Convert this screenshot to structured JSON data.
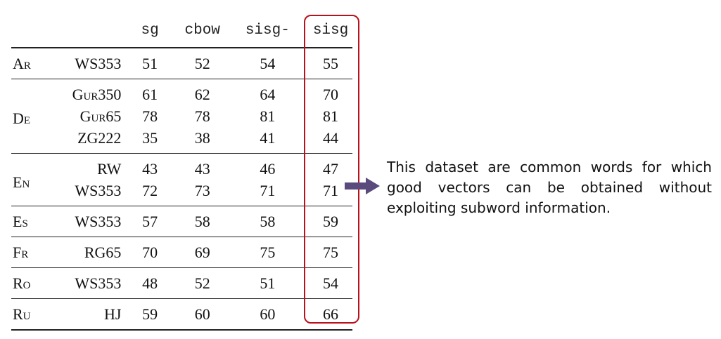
{
  "table": {
    "headers": [
      "sg",
      "cbow",
      "sisg-",
      "sisg"
    ],
    "groups": [
      {
        "lang": "Ar",
        "rows": [
          {
            "dataset": "WS353",
            "sg": "51",
            "cbow": "52",
            "sisg_minus": "54",
            "sisg": "55"
          }
        ]
      },
      {
        "lang": "De",
        "rows": [
          {
            "dataset": "Gur350",
            "sg": "61",
            "cbow": "62",
            "sisg_minus": "64",
            "sisg": "70"
          },
          {
            "dataset": "Gur65",
            "sg": "78",
            "cbow": "78",
            "sisg_minus": "81",
            "sisg": "81"
          },
          {
            "dataset": "ZG222",
            "sg": "35",
            "cbow": "38",
            "sisg_minus": "41",
            "sisg": "44"
          }
        ]
      },
      {
        "lang": "En",
        "rows": [
          {
            "dataset": "RW",
            "sg": "43",
            "cbow": "43",
            "sisg_minus": "46",
            "sisg": "47"
          },
          {
            "dataset": "WS353",
            "sg": "72",
            "cbow": "73",
            "sisg_minus": "71",
            "sisg": "71"
          }
        ]
      },
      {
        "lang": "Es",
        "rows": [
          {
            "dataset": "WS353",
            "sg": "57",
            "cbow": "58",
            "sisg_minus": "58",
            "sisg": "59"
          }
        ]
      },
      {
        "lang": "Fr",
        "rows": [
          {
            "dataset": "RG65",
            "sg": "70",
            "cbow": "69",
            "sisg_minus": "75",
            "sisg": "75"
          }
        ]
      },
      {
        "lang": "Ro",
        "rows": [
          {
            "dataset": "WS353",
            "sg": "48",
            "cbow": "52",
            "sisg_minus": "51",
            "sisg": "54"
          }
        ]
      },
      {
        "lang": "Ru",
        "rows": [
          {
            "dataset": "HJ",
            "sg": "59",
            "cbow": "60",
            "sisg_minus": "60",
            "sisg": "66"
          }
        ]
      }
    ]
  },
  "annotation": {
    "text": "This dataset are common words for which good vectors can be obtained without exploiting subword information.",
    "arrow_color": "#5b4b7d",
    "highlight_color": "#b8121b"
  }
}
